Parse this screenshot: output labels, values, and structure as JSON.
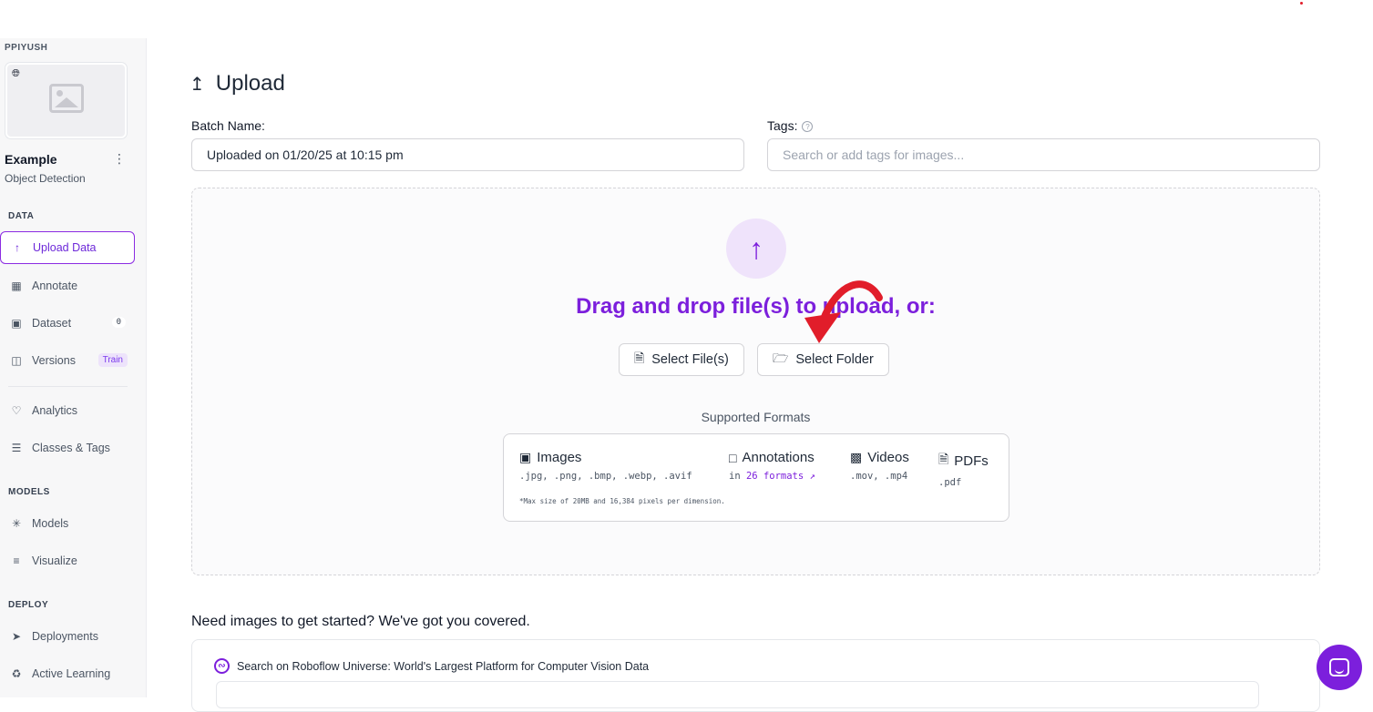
{
  "sidebar": {
    "workspace": "PPIYUSH",
    "project_name": "Example",
    "project_type": "Object Detection",
    "sections": {
      "data": "DATA",
      "models": "MODELS",
      "deploy": "DEPLOY"
    },
    "items": {
      "upload": "Upload Data",
      "annotate": "Annotate",
      "dataset": "Dataset",
      "dataset_count": "0",
      "versions": "Versions",
      "versions_badge": "Train",
      "analytics": "Analytics",
      "classes": "Classes & Tags",
      "models": "Models",
      "visualize": "Visualize",
      "deployments": "Deployments",
      "active_learning": "Active Learning"
    }
  },
  "main": {
    "title": "Upload",
    "batch_label": "Batch Name:",
    "batch_value": "Uploaded on 01/20/25 at 10:15 pm",
    "tags_label": "Tags:",
    "tags_placeholder": "Search or add tags for images...",
    "drop_text": "Drag and drop file(s) to upload, or:",
    "select_files": "Select File(s)",
    "select_folder": "Select Folder",
    "supported_title": "Supported Formats",
    "formats": {
      "images": {
        "title": "Images",
        "ext": ".jpg, .png, .bmp, .webp, .avif"
      },
      "annotations": {
        "title": "Annotations",
        "prefix": "in",
        "link": "26 formats"
      },
      "videos": {
        "title": "Videos",
        "ext": ".mov, .mp4"
      },
      "pdfs": {
        "title": "PDFs",
        "ext": ".pdf"
      },
      "note": "*Max size of 20MB and 16,384 pixels per dimension."
    },
    "need_images": "Need images to get started? We've got you covered.",
    "universe_text": "Search on Roboflow Universe: World's Largest Platform for Computer Vision Data"
  },
  "colors": {
    "accent": "#7c1fdc",
    "annotation_arrow": "#e11d2a"
  },
  "icons": [
    "globe-icon",
    "image-placeholder-icon",
    "kebab-icon",
    "upload-arrow-icon",
    "annotate-icon",
    "dataset-icon",
    "versions-icon",
    "analytics-icon",
    "classes-icon",
    "models-icon",
    "visualize-icon",
    "deployments-icon",
    "active-learning-icon",
    "help-icon",
    "file-icon",
    "folder-icon",
    "image-icon",
    "annotation-icon",
    "video-icon",
    "pdf-icon",
    "external-link-icon",
    "universe-logo-icon",
    "chat-icon"
  ]
}
